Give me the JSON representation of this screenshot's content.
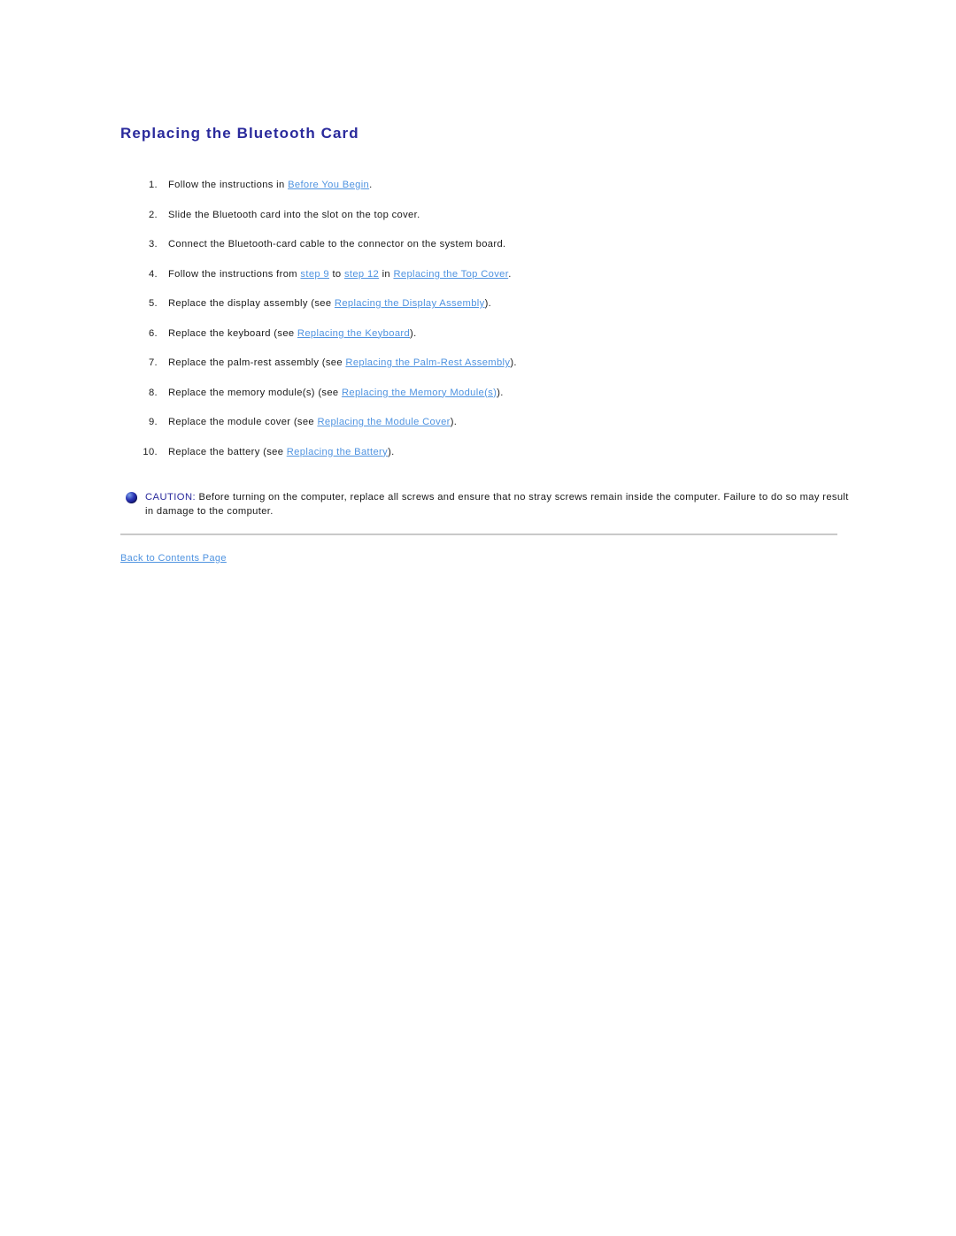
{
  "document": {
    "title": "Replacing the Bluetooth Card"
  },
  "colors": {
    "heading": "#2a2a9c",
    "link": "#4f93e0",
    "body_text": "#1a1a1a",
    "divider": "#c9c9c9",
    "caution_icon": "#2b35b4",
    "background": "#ffffff"
  },
  "steps": [
    {
      "number": "1.",
      "parts": [
        {
          "type": "text",
          "value": "Follow the instructions in "
        },
        {
          "type": "link",
          "value": "Before You Begin"
        },
        {
          "type": "text",
          "value": "."
        }
      ]
    },
    {
      "number": "2.",
      "parts": [
        {
          "type": "text",
          "value": "Slide the Bluetooth card into the slot on the top cover."
        }
      ]
    },
    {
      "number": "3.",
      "parts": [
        {
          "type": "text",
          "value": "Connect the Bluetooth-card cable to the connector on the system board."
        }
      ]
    },
    {
      "number": "4.",
      "parts": [
        {
          "type": "text",
          "value": "Follow the instructions from "
        },
        {
          "type": "link",
          "value": "step 9"
        },
        {
          "type": "text",
          "value": " to "
        },
        {
          "type": "link",
          "value": "step 12"
        },
        {
          "type": "text",
          "value": " in "
        },
        {
          "type": "link",
          "value": "Replacing the Top Cover"
        },
        {
          "type": "text",
          "value": "."
        }
      ]
    },
    {
      "number": "5.",
      "parts": [
        {
          "type": "text",
          "value": "Replace the display assembly (see "
        },
        {
          "type": "link",
          "value": "Replacing the Display Assembly"
        },
        {
          "type": "text",
          "value": ")."
        }
      ]
    },
    {
      "number": "6.",
      "parts": [
        {
          "type": "text",
          "value": "Replace the keyboard (see "
        },
        {
          "type": "link",
          "value": "Replacing the Keyboard"
        },
        {
          "type": "text",
          "value": ")."
        }
      ]
    },
    {
      "number": "7.",
      "parts": [
        {
          "type": "text",
          "value": "Replace the palm-rest assembly (see "
        },
        {
          "type": "link",
          "value": "Replacing the Palm-Rest Assembly"
        },
        {
          "type": "text",
          "value": ")."
        }
      ]
    },
    {
      "number": "8.",
      "parts": [
        {
          "type": "text",
          "value": "Replace the memory module(s) (see "
        },
        {
          "type": "link",
          "value": "Replacing the Memory Module(s)"
        },
        {
          "type": "text",
          "value": ")."
        }
      ]
    },
    {
      "number": "9.",
      "parts": [
        {
          "type": "text",
          "value": "Replace the module cover (see "
        },
        {
          "type": "link",
          "value": "Replacing the Module Cover"
        },
        {
          "type": "text",
          "value": ")."
        }
      ]
    },
    {
      "number": "10.",
      "parts": [
        {
          "type": "text",
          "value": "Replace the battery (see "
        },
        {
          "type": "link",
          "value": "Replacing the Battery"
        },
        {
          "type": "text",
          "value": ")."
        }
      ]
    }
  ],
  "caution": {
    "icon": "caution-sphere-icon",
    "label": "CAUTION:",
    "text": " Before turning on the computer, replace all screws and ensure that no stray screws remain inside the computer. Failure to do so may result in damage to the computer."
  },
  "footer": {
    "back_link": "Back to Contents Page"
  }
}
